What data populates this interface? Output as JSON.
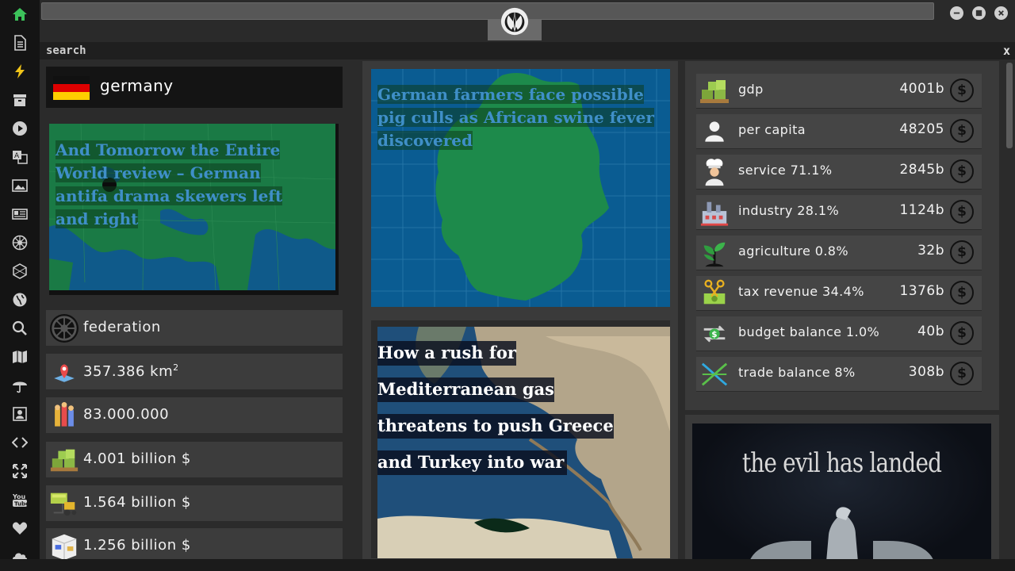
{
  "window": {
    "title_input": "",
    "logo_icon": "rebel-alliance-icon",
    "controls": [
      "minimize-icon",
      "maximize-icon",
      "close-icon"
    ]
  },
  "sidebar": {
    "icons": [
      "home-icon",
      "document-icon",
      "lightning-icon",
      "archive-icon",
      "play-icon",
      "translate-icon",
      "image-icon",
      "newspaper-icon",
      "empire-icon",
      "hexagon-icon",
      "globe-icon",
      "search-icon",
      "map-icon",
      "umbrella-icon",
      "contact-icon",
      "code-icon",
      "expand-icon",
      "youtube-icon",
      "heart-icon",
      "cloud-icon"
    ]
  },
  "search": {
    "label": "search",
    "close": "x"
  },
  "country": {
    "name": "germany",
    "flag_colors": [
      "#000000",
      "#dd0000",
      "#ffce00"
    ]
  },
  "news_left": {
    "title": "And Tomorrow the Entire World review – German antifa drama skewers left and right"
  },
  "stats": [
    {
      "icon": "empire-emblem-icon",
      "text": "federation"
    },
    {
      "icon": "map-pin-icon",
      "text": "357.386 km",
      "sup": "2"
    },
    {
      "icon": "population-icon",
      "text": "83.000.000"
    },
    {
      "icon": "money-pallet-icon",
      "text": "4.001 billion $"
    },
    {
      "icon": "money-forklift-icon",
      "text": "1.564 billion $"
    },
    {
      "icon": "money-box-icon",
      "text": "1.256 billion $"
    }
  ],
  "news_mid": [
    {
      "title": "German farmers face possible pig culls as African swine fever discovered"
    },
    {
      "title": "How a rush for Mediterranean gas threatens to push Greece and Turkey into war"
    }
  ],
  "economy": [
    {
      "icon": "money-pallet-icon",
      "label": "gdp",
      "value": "4001b"
    },
    {
      "icon": "person-icon",
      "label": "per capita",
      "value": "48205"
    },
    {
      "icon": "chef-icon",
      "label": "service 71.1%",
      "value": "2845b"
    },
    {
      "icon": "factory-icon",
      "label": "industry 28.1%",
      "value": "1124b"
    },
    {
      "icon": "plant-icon",
      "label": "agriculture 0.8%",
      "value": "32b"
    },
    {
      "icon": "tax-scissors-icon",
      "label": "tax revenue 34.4%",
      "value": "1376b"
    },
    {
      "icon": "exchange-icon",
      "label": "budget balance 1.0%",
      "value": "40b"
    },
    {
      "icon": "trade-cross-icon",
      "label": "trade balance 8%",
      "value": "308b"
    }
  ],
  "currency_symbol": "$",
  "promo": {
    "title": "the evil has landed"
  }
}
